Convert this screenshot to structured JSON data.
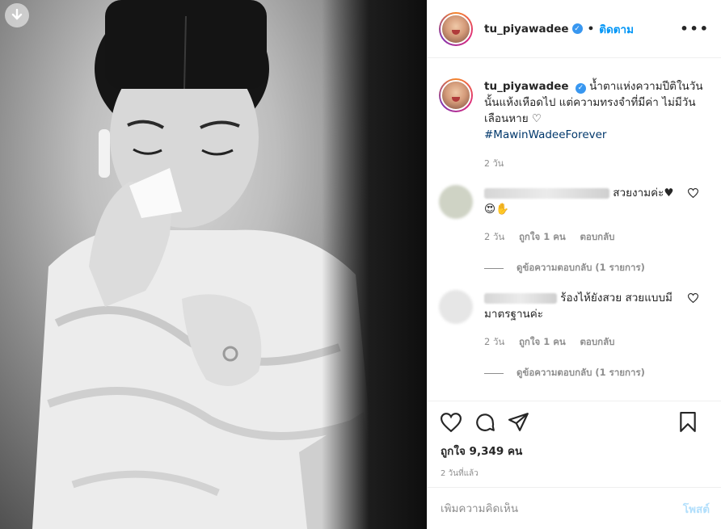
{
  "post": {
    "username": "tu_piyawadee",
    "follow_label": "ติดตาม",
    "more_label": "•••"
  },
  "caption": {
    "username": "tu_piyawadee",
    "text": "น้ำตาแห่งความปีติในวันนั้นแห้งเหือดไป แต่ความทรงจำที่มีค่า ไม่มีวันเลือนหาย ♡",
    "hashtag": "#MawinWadeeForever",
    "time": "2 วัน"
  },
  "comments": [
    {
      "text": "สวยงามค่ะ♥😍✋",
      "time": "2 วัน",
      "likes": "ถูกใจ 1 คน",
      "reply": "ตอบกลับ",
      "view_replies": "ดูข้อความตอบกลับ (1 รายการ)"
    },
    {
      "text": "ร้องไห้ยังสวย สวยแบบมีมาตรฐานค่ะ",
      "time": "2 วัน",
      "likes": "ถูกใจ 1 คน",
      "reply": "ตอบกลับ",
      "view_replies": "ดูข้อความตอบกลับ (1 รายการ)"
    }
  ],
  "stats": {
    "likes": "ถูกใจ 9,349 คน",
    "ago": "2 วันที่แล้ว"
  },
  "add_comment": {
    "placeholder": "เพิ่มความคิดเห็น",
    "post_label": "โพสต์"
  },
  "icons": [
    "download-icon",
    "verified-icon",
    "more-icon",
    "heart-icon",
    "comment-icon",
    "share-icon",
    "bookmark-icon"
  ],
  "colors": {
    "link_blue": "#0095f6",
    "verified_blue": "#3897f0",
    "hashtag": "#00376b",
    "muted": "#8e8e8e",
    "post_disabled": "#b2dffc"
  }
}
